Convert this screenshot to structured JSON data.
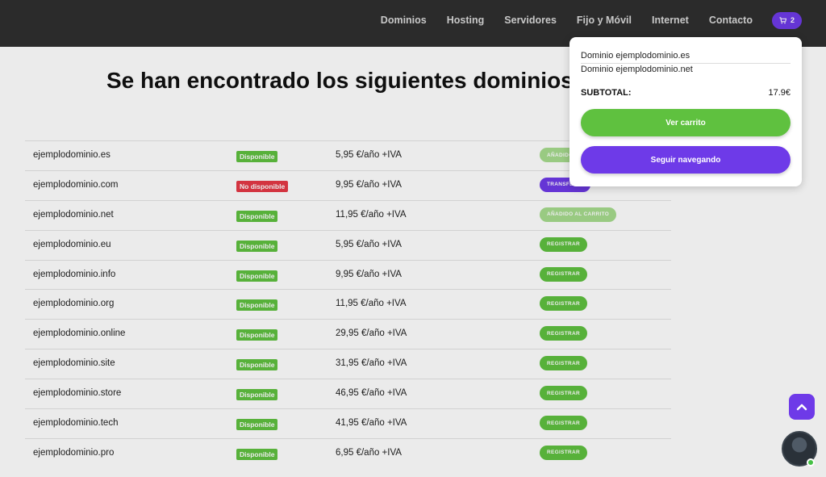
{
  "nav": {
    "items": [
      "Dominios",
      "Hosting",
      "Servidores",
      "Fijo y Móvil",
      "Internet",
      "Contacto"
    ],
    "cart_count": "2",
    "cart_icon": "cart-icon"
  },
  "main": {
    "heading": "Se han encontrado los siguientes dominios"
  },
  "domains": [
    {
      "name": "ejemplodominio.es",
      "status": "Disponible",
      "price": "5,95 €/año +IVA",
      "action": "AÑADIDO AL CARRITO"
    },
    {
      "name": "ejemplodominio.com",
      "status": "No disponible",
      "price": "9,95 €/año +IVA",
      "action": "TRANSFERIR"
    },
    {
      "name": "ejemplodominio.net",
      "status": "Disponible",
      "price": "11,95 €/año +IVA",
      "action": "AÑADIDO AL CARRITO"
    },
    {
      "name": "ejemplodominio.eu",
      "status": "Disponible",
      "price": "5,95 €/año +IVA",
      "action": "REGISTRAR"
    },
    {
      "name": "ejemplodominio.info",
      "status": "Disponible",
      "price": "9,95 €/año +IVA",
      "action": "REGISTRAR"
    },
    {
      "name": "ejemplodominio.org",
      "status": "Disponible",
      "price": "11,95 €/año +IVA",
      "action": "REGISTRAR"
    },
    {
      "name": "ejemplodominio.online",
      "status": "Disponible",
      "price": "29,95 €/año +IVA",
      "action": "REGISTRAR"
    },
    {
      "name": "ejemplodominio.site",
      "status": "Disponible",
      "price": "31,95 €/año +IVA",
      "action": "REGISTRAR"
    },
    {
      "name": "ejemplodominio.store",
      "status": "Disponible",
      "price": "46,95 €/año +IVA",
      "action": "REGISTRAR"
    },
    {
      "name": "ejemplodominio.tech",
      "status": "Disponible",
      "price": "41,95 €/año +IVA",
      "action": "REGISTRAR"
    },
    {
      "name": "ejemplodominio.pro",
      "status": "Disponible",
      "price": "6,95 €/año +IVA",
      "action": "REGISTRAR"
    }
  ],
  "cart_popup": {
    "items": [
      "Dominio ejemplodominio.es",
      "Dominio ejemplodominio.net"
    ],
    "subtotal_label": "SUBTOTAL:",
    "subtotal_value": "17.9€",
    "view_cart_label": "Ver carrito",
    "continue_label": "Seguir navegando"
  },
  "colors": {
    "nav_bg": "#2f2f2f",
    "accent_purple": "#6e3ae8",
    "accent_green": "#5fc13f",
    "status_red": "#e53946"
  },
  "icons": {
    "scroll_top": "chevron-up-icon",
    "chat": "chat-avatar"
  }
}
